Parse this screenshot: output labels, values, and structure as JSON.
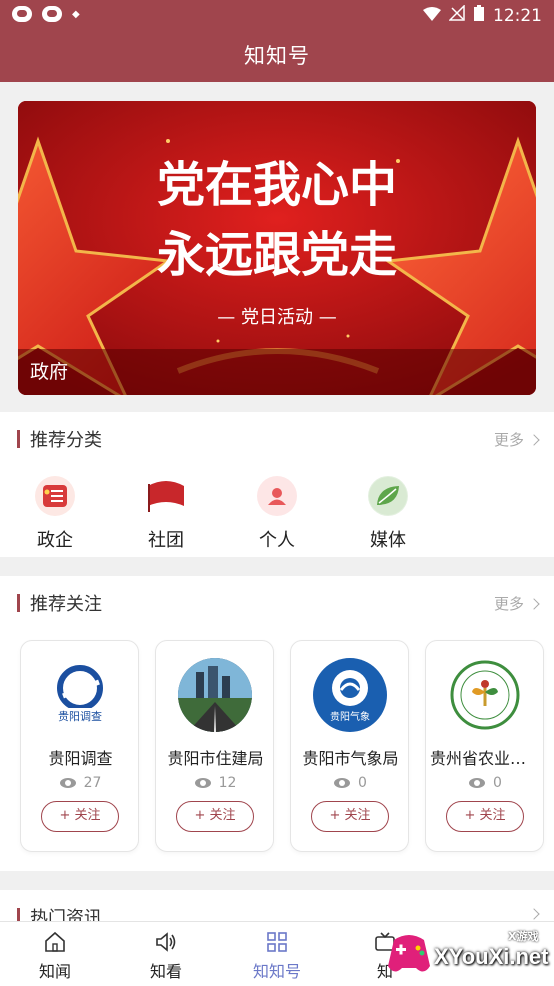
{
  "status_bar": {
    "time": "12:21",
    "wifi_icon": "wifi-icon",
    "signal_icon": "signal-off-icon",
    "battery_icon": "battery-icon"
  },
  "header": {
    "title": "知知号"
  },
  "banner": {
    "headline_line1": "党在我心中",
    "headline_line2": "永远跟党走",
    "subline": "— 党日活动 —",
    "caption": "政府"
  },
  "categories": {
    "title": "推荐分类",
    "more": "更多",
    "items": [
      {
        "label": "政企",
        "icon": "government-icon",
        "color": "#d83a3a"
      },
      {
        "label": "社团",
        "icon": "flag-icon",
        "color": "#c8272b"
      },
      {
        "label": "个人",
        "icon": "person-icon",
        "color": "#e8585a"
      },
      {
        "label": "媒体",
        "icon": "leaf-icon",
        "color": "#5ea64b"
      }
    ]
  },
  "follows": {
    "title": "推荐关注",
    "more": "更多",
    "follow_label": "+ 关注",
    "items": [
      {
        "name": "贵阳调查",
        "views": "27",
        "logo_text": "贵阳调查"
      },
      {
        "name": "贵阳市住建局",
        "views": "12",
        "logo_text": ""
      },
      {
        "name": "贵阳市气象局",
        "views": "0",
        "logo_text": "贵阳气象"
      },
      {
        "name": "贵州省农业农…",
        "views": "0",
        "logo_text": ""
      }
    ]
  },
  "hot_news": {
    "title": "热门资讯"
  },
  "bottom_nav": {
    "items": [
      {
        "label": "知闻",
        "icon": "home-icon"
      },
      {
        "label": "知看",
        "icon": "speaker-icon"
      },
      {
        "label": "知知号",
        "icon": "grid-icon"
      },
      {
        "label": "知",
        "icon": "tv-icon"
      }
    ],
    "active": "知知号"
  },
  "watermark": {
    "text": "XYouXi.net",
    "sub": "X游戏"
  }
}
